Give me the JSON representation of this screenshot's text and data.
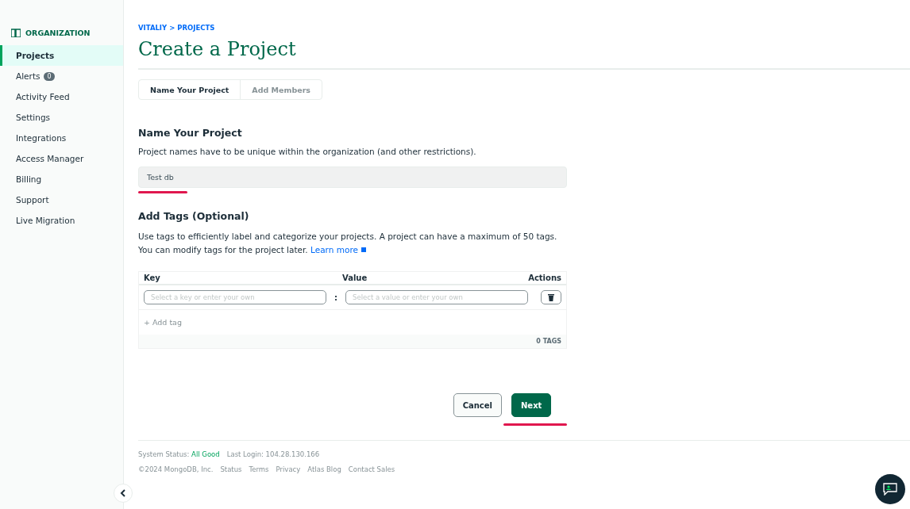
{
  "sidebar": {
    "org_label": "ORGANIZATION",
    "items": [
      {
        "label": "Projects",
        "selected": true
      },
      {
        "label": "Alerts",
        "selected": false,
        "badge": "0"
      },
      {
        "label": "Activity Feed",
        "selected": false
      },
      {
        "label": "Settings",
        "selected": false
      },
      {
        "label": "Integrations",
        "selected": false
      },
      {
        "label": "Access Manager",
        "selected": false
      },
      {
        "label": "Billing",
        "selected": false
      },
      {
        "label": "Support",
        "selected": false
      },
      {
        "label": "Live Migration",
        "selected": false
      }
    ]
  },
  "breadcrumb": "VITALIY > PROJECTS",
  "title": "Create a Project",
  "steps": [
    {
      "label": "Name Your Project",
      "selected": true
    },
    {
      "label": "Add Members",
      "selected": false
    }
  ],
  "name_section": {
    "heading": "Name Your Project",
    "description": "Project names have to be unique within the organization (and other restrictions).",
    "field": {
      "value": "Test db",
      "highlighted": true
    }
  },
  "tags_section": {
    "heading": "Add Tags (Optional)",
    "description": "Use tags to efficiently label and categorize your projects. A project can have a maximum of 50 tags. You can modify tags for the project later.",
    "link": "Learn more",
    "table": {
      "columns": [
        "Key",
        "Value",
        "Actions"
      ],
      "rows": [
        {
          "key_placeholder": "Select a key or enter your own",
          "separator": ":",
          "value_placeholder": "Select a value or enter your own"
        }
      ],
      "add_label": "+ Add tag",
      "count": "0 TAGS"
    }
  },
  "buttons": [
    {
      "label": "Cancel",
      "kind": "secondary",
      "highlighted": false
    },
    {
      "label": "Next",
      "kind": "primary",
      "highlighted": true
    }
  ],
  "footer": {
    "status_label": "System Status:",
    "status_value": "All Good",
    "last_login": "Last Login: 104.28.130.166",
    "copyright": "©2024 MongoDB, Inc.",
    "links": [
      "Status",
      "Terms",
      "Privacy",
      "Atlas Blog",
      "Contact Sales"
    ]
  }
}
